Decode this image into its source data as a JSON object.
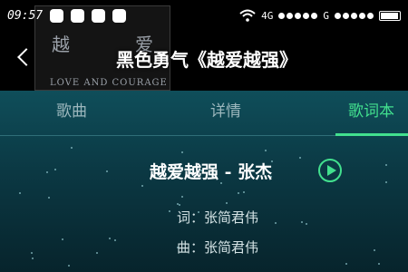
{
  "status_bar": {
    "time": "09:57",
    "network_4g": "4G",
    "network_g": "G"
  },
  "header": {
    "title": "黑色勇气《越爱越强》",
    "cover": {
      "char_1": "越",
      "char_2": "爱",
      "caption": "LOVE AND COURAGE"
    }
  },
  "tabs": [
    {
      "label": "歌曲"
    },
    {
      "label": "详情"
    },
    {
      "label": "歌词本"
    }
  ],
  "song": {
    "title": "越爱越强 - 张杰",
    "lyricist": "词：张简君伟",
    "composer": "曲：张简君伟"
  },
  "colors": {
    "accent": "#42e08e",
    "background_top": "#0f4e5a",
    "background_bottom": "#07242c"
  },
  "icons": [
    "weibo-icon",
    "notification-icon",
    "qq-icon",
    "shield-icon",
    "wifi-icon",
    "battery-icon",
    "back-icon",
    "play-icon"
  ]
}
